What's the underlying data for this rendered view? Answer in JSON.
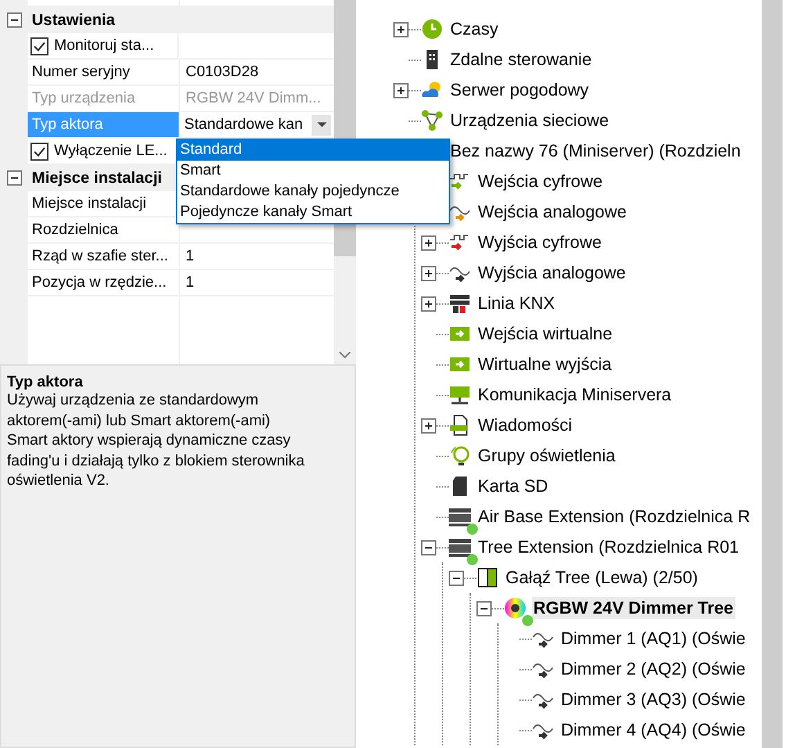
{
  "properties": {
    "groups": [
      {
        "title": "Ustawienia",
        "expanded": true,
        "rows": [
          {
            "kind": "checkbox",
            "label": "Monitoruj sta...",
            "checked": true,
            "selected": false
          },
          {
            "kind": "text",
            "label": "Numer seryjny",
            "value": "C0103D28",
            "disabled": false,
            "selected": false
          },
          {
            "kind": "text",
            "label": "Typ urządzenia",
            "value": "RGBW 24V Dimm...",
            "disabled": true,
            "selected": false
          },
          {
            "kind": "dropdown",
            "label": "Typ aktora",
            "value": "Standardowe kan",
            "disabled": false,
            "selected": true
          },
          {
            "kind": "checkbox",
            "label": "Wyłączenie LE...",
            "checked": true,
            "selected": false
          }
        ]
      },
      {
        "title": "Miejsce instalacji",
        "expanded": true,
        "rows": [
          {
            "kind": "text",
            "label": "Miejsce instalacji",
            "disabled": false,
            "selected": false
          },
          {
            "kind": "text",
            "label": "Rozdzielnica",
            "disabled": false,
            "selected": false
          },
          {
            "kind": "text",
            "label": "Rząd w szafie ster...",
            "value": "1",
            "disabled": false,
            "selected": false
          },
          {
            "kind": "text",
            "label": "Pozycja w rzędzie...",
            "value": "1",
            "disabled": false,
            "selected": false
          }
        ]
      }
    ]
  },
  "dropdown_options": [
    {
      "label": "Standard",
      "selected": true
    },
    {
      "label": "Smart",
      "selected": false
    },
    {
      "label": "Standardowe kanały pojedyncze",
      "selected": false
    },
    {
      "label": "Pojedyncze kanały Smart",
      "selected": false
    }
  ],
  "description": {
    "title": "Typ aktora",
    "lines": [
      "Używaj urządzenia ze standardowym",
      "aktorem(-ami) lub Smart aktorem(-ami)",
      "Smart aktory wspierają dynamiczne czasy",
      "fading'u i działają tylko z blokiem sterownika",
      "oświetlenia V2."
    ]
  },
  "tree": [
    {
      "label": "Czasy",
      "kind": "clock",
      "expanded": false,
      "online": false,
      "selected": false
    },
    {
      "label": "Zdalne sterowanie",
      "kind": "remote",
      "online": false,
      "selected": false
    },
    {
      "label": "Serwer pogodowy",
      "kind": "weather",
      "expanded": false,
      "online": false,
      "selected": false
    },
    {
      "label": "Urządzenia sieciowe",
      "kind": "network",
      "online": false,
      "selected": false
    },
    {
      "label": "Bez nazwy 76 (Miniserver) (Rozdzieln",
      "kind": "hidden",
      "online": false,
      "selected": false,
      "children": [
        {
          "label": "Wejścia cyfrowe",
          "kind": "digital-in",
          "online": false,
          "selected": false
        },
        {
          "label": "Wejścia analogowe",
          "kind": "analog-in",
          "online": false,
          "selected": false
        },
        {
          "label": "Wyjścia cyfrowe",
          "kind": "digital-out",
          "expanded": false,
          "online": false,
          "selected": false
        },
        {
          "label": "Wyjścia analogowe",
          "kind": "analog-out",
          "expanded": false,
          "online": false,
          "selected": false
        },
        {
          "label": "Linia KNX",
          "kind": "knx",
          "expanded": false,
          "online": false,
          "selected": false
        },
        {
          "label": "Wejścia wirtualne",
          "kind": "virtual",
          "online": false,
          "selected": false
        },
        {
          "label": "Wirtualne wyjścia",
          "kind": "virtual",
          "online": false,
          "selected": false
        },
        {
          "label": "Komunikacja Miniservera",
          "kind": "monitor",
          "online": false,
          "selected": false
        },
        {
          "label": "Wiadomości",
          "kind": "log",
          "expanded": false,
          "online": false,
          "selected": false
        },
        {
          "label": "Grupy oświetlenia",
          "kind": "bulb",
          "online": false,
          "selected": false
        },
        {
          "label": "Karta SD",
          "kind": "sd",
          "online": false,
          "selected": false
        },
        {
          "label": "Air Base Extension (Rozdzielnica R",
          "kind": "extension",
          "online": true,
          "selected": false
        },
        {
          "label": "Tree Extension (Rozdzielnica R01",
          "kind": "extension",
          "expanded": true,
          "online": true,
          "selected": false,
          "children": [
            {
              "label": "Gałąź Tree (Lewa) (2/50)",
              "kind": "branch",
              "expanded": true,
              "online": false,
              "selected": false,
              "children": [
                {
                  "label": "RGBW 24V Dimmer Tree",
                  "kind": "rgb",
                  "expanded": true,
                  "online": true,
                  "selected": true,
                  "children": [
                    {
                      "label": "Dimmer 1 (AQ1) (Oświe",
                      "kind": "analog-out",
                      "online": false,
                      "selected": false
                    },
                    {
                      "label": "Dimmer 2 (AQ2) (Oświe",
                      "kind": "analog-out",
                      "online": false,
                      "selected": false
                    },
                    {
                      "label": "Dimmer 3 (AQ3) (Oświe",
                      "kind": "analog-out",
                      "online": false,
                      "selected": false
                    },
                    {
                      "label": "Dimmer 4 (AQ4) (Oświe",
                      "kind": "analog-out",
                      "online": false,
                      "selected": false
                    }
                  ]
                }
              ]
            }
          ]
        }
      ]
    }
  ]
}
